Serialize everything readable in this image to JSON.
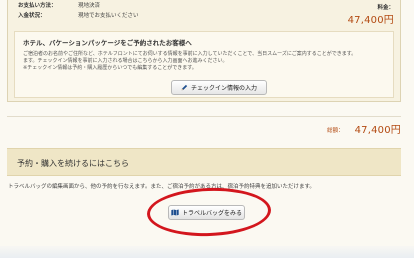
{
  "payment": {
    "method_label": "お支払い方法：",
    "method_value": "現地決済",
    "deposit_label": "入金状況：",
    "deposit_value": "現地でお支払いください",
    "fee_label": "料金：",
    "fee_value": "47,400円"
  },
  "hotel_notice": {
    "title": "ホテル、バケーションパッケージをご予約されたお客様へ",
    "line1": "ご宿泊者のお名前やご住所など、ホテルフロントにてお伺いする情報を事前に入力していただくことで、当日スムーズにご案内することができます。",
    "line2": "ます。チェックイン情報を事前に入力される場合はこちらから入力画面へお進みください。",
    "line3": "※チェックイン情報は予約・購入履歴からいつでも編集することができます。",
    "button_label": "チェックイン情報の入力"
  },
  "total": {
    "label": "総額：",
    "value": "47,400円"
  },
  "continue_section": {
    "title": "予約・購入を続けるにはこちら",
    "description": "トラベルバッグの編集画面から、他の予約を行なえます。また、ご宿泊予約がある方は、宿泊予約特典を追加いただけます。",
    "button_label": "トラベルバッグをみる"
  },
  "colors": {
    "accent_price": "#b34a12",
    "highlight_circle": "#d3161d",
    "section_bg": "#efe6c6"
  },
  "icons": {
    "checkin_button_icon": "pencil-icon",
    "bag_button_icon": "map-icon"
  }
}
